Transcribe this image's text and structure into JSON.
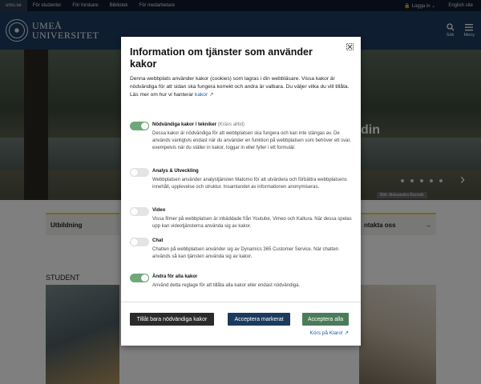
{
  "topbar": {
    "site": "umu.se",
    "links": [
      "För studenter",
      "För forskare",
      "Bibliotek",
      "För medarbetare"
    ],
    "login": "Logga in",
    "english": "English site"
  },
  "header": {
    "logo_line1": "UMEÅ",
    "logo_line2": "UNIVERSITET",
    "search_label": "Sök",
    "menu_label": "Meny"
  },
  "hero": {
    "heading_fragment": "din",
    "credit": "Bild: Aleksandra Bozovik",
    "slides_count": 5
  },
  "cards": {
    "left": "Utbildning",
    "right": "ntakta oss",
    "right_arrow": "→"
  },
  "section": {
    "label": "STUDENT"
  },
  "modal": {
    "title": "Information om tjänster som använder kakor",
    "intro": "Denna webbplats använder kakor (cookies) som lagras i din webbläsare. Vissa kakor är nödvändiga för att sidan ska fungera korrekt och andra är valbara. Du väljer vilka du vill tillåta. Läs mer om hur vi hanterar",
    "intro_link": "kakor",
    "options": [
      {
        "title": "Nödvändiga kakor / tekniker",
        "required": "(Krävs alltid)",
        "on": true,
        "desc": "Dessa kakor är nödvändiga för att webbplatsen ska fungera och kan inte stängas av. De används vanligtvis endast när du använder en funktion på webbplatsen som behöver ett svar, exempelvis när du ställer in kakor, loggar in eller fyller i ett formulär."
      },
      {
        "title": "Analys & Utveckling",
        "on": false,
        "desc": "Webbplatsen använder analystjänsten Matomo för att utvärdera och förbättra webbplatsens innehåll, upplevelse och struktur. Insamlandet av informationen anonymiseras."
      },
      {
        "title": "Video",
        "on": false,
        "desc": "Vissa filmer på webbplatsen är inbäddade från Youtube, Vimeo och Kaltura. När dessa spelas upp kan videotjänsterna använda sig av kakor."
      },
      {
        "title": "Chat",
        "on": false,
        "desc": "Chatten på webbplatsen använder sig av Dynamics 365 Customer Service. När chatten används så kan tjänsten använda sig av kakor."
      },
      {
        "title": "Ändra för alla kakor",
        "on": true,
        "desc": "Använd detta reglage för att tillåta alla kakor eller endast nödvändiga."
      }
    ],
    "buttons": {
      "necessary": "Tillåt bara nödvändiga kakor",
      "accept_selected": "Acceptera markerat",
      "accept_all": "Acceptera alla"
    },
    "klaro": "Körs på Klaro!"
  },
  "colors": {
    "header": "#1c3a5e",
    "topbar": "#0f1b2e",
    "accent_yellow": "#e6d03a",
    "toggle_on": "#6fa878",
    "accept_all": "#4a7c5a"
  }
}
